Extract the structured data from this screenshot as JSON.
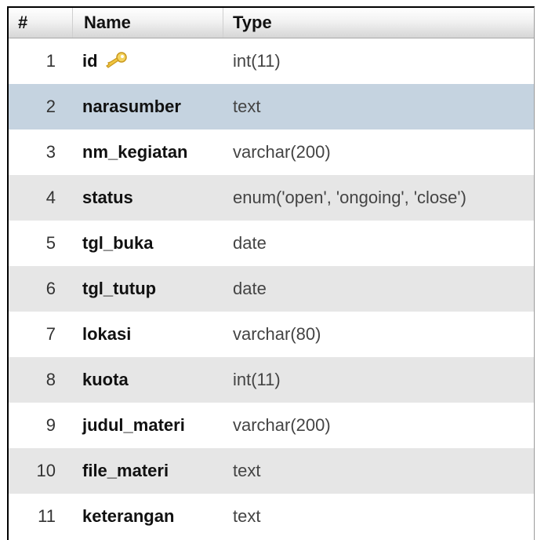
{
  "table": {
    "headers": {
      "num": "#",
      "name": "Name",
      "type": "Type"
    },
    "rows": [
      {
        "num": "1",
        "name": "id",
        "type": "int(11)",
        "primary_key": true
      },
      {
        "num": "2",
        "name": "narasumber",
        "type": "text",
        "selected": true
      },
      {
        "num": "3",
        "name": "nm_kegiatan",
        "type": "varchar(200)"
      },
      {
        "num": "4",
        "name": "status",
        "type": "enum('open', 'ongoing', 'close')"
      },
      {
        "num": "5",
        "name": "tgl_buka",
        "type": "date"
      },
      {
        "num": "6",
        "name": "tgl_tutup",
        "type": "date"
      },
      {
        "num": "7",
        "name": "lokasi",
        "type": "varchar(80)"
      },
      {
        "num": "8",
        "name": "kuota",
        "type": "int(11)"
      },
      {
        "num": "9",
        "name": "judul_materi",
        "type": "varchar(200)"
      },
      {
        "num": "10",
        "name": "file_materi",
        "type": "text"
      },
      {
        "num": "11",
        "name": "keterangan",
        "type": "text"
      }
    ]
  },
  "icons": {
    "primary_key": "key-icon"
  },
  "colors": {
    "row_even": "#e6e6e6",
    "row_selected": "#c5d3e0",
    "key_gold": "#e8b923"
  }
}
